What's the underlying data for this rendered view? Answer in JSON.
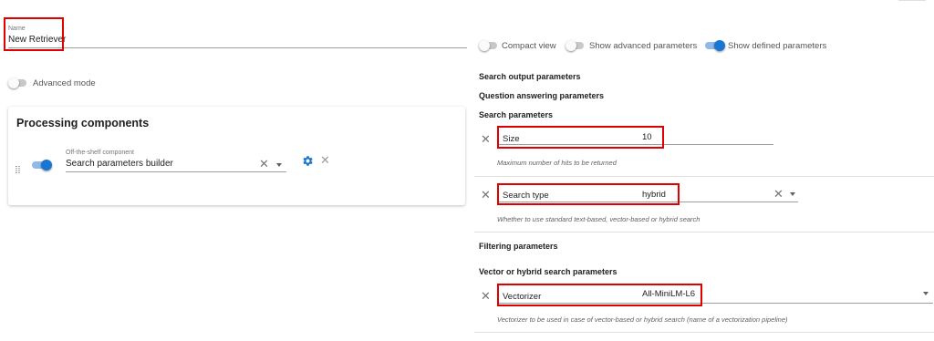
{
  "name_field": {
    "label": "Name",
    "value": "New Retriever"
  },
  "view_toggles": [
    {
      "label": "Compact view",
      "on": false
    },
    {
      "label": "Show advanced parameters",
      "on": false
    },
    {
      "label": "Show defined parameters",
      "on": true
    }
  ],
  "advanced_mode": {
    "label": "Advanced mode",
    "on": false
  },
  "processing": {
    "title": "Processing components",
    "component": {
      "enabled": true,
      "field_label": "Off-the-shelf component",
      "value": "Search parameters builder"
    }
  },
  "sections": {
    "search_output": "Search output parameters",
    "question_answering": "Question answering parameters",
    "search": "Search parameters",
    "filtering": "Filtering parameters",
    "vector": "Vector or hybrid search parameters"
  },
  "params": {
    "size": {
      "label": "Size",
      "value": "10",
      "help": "Maximum number of hits to be returned"
    },
    "search_type": {
      "label": "Search type",
      "value": "hybrid",
      "help": "Whether to use standard text-based, vector-based or hybrid search"
    },
    "vectorizer": {
      "label": "Vectorizer",
      "value": "All-MiniLM-L6",
      "help": "Vectorizer to be used in case of vector-based or hybrid search (name of a vectorization pipeline)"
    }
  },
  "colors": {
    "accent": "#1976d2",
    "highlight": "#e00000"
  },
  "icons": [
    "close-icon",
    "chevron-down-icon",
    "gear-icon",
    "drag-handle-icon"
  ]
}
